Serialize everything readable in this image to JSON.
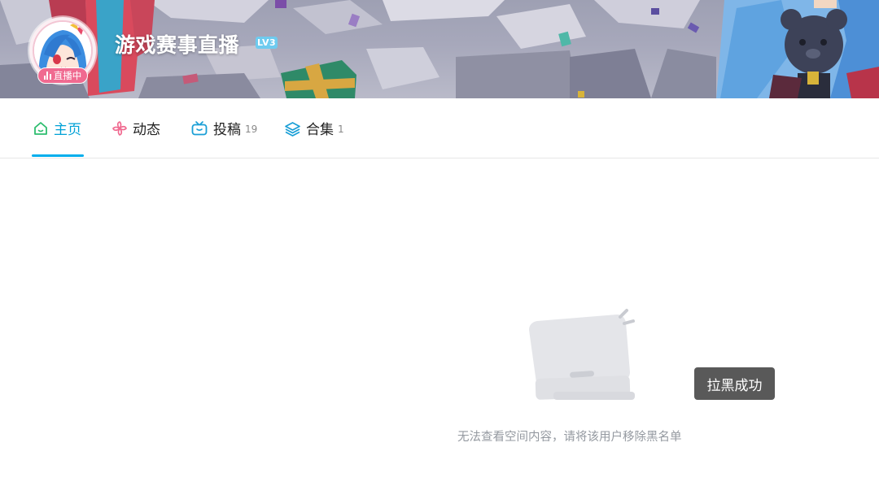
{
  "profile": {
    "username": "游戏赛事直播",
    "level": "LV3",
    "live_badge": "直播中"
  },
  "tabs": [
    {
      "label": "主页",
      "count": "",
      "icon": "home-icon",
      "active": true
    },
    {
      "label": "动态",
      "count": "",
      "icon": "pinwheel-icon",
      "active": false
    },
    {
      "label": "投稿",
      "count": "19",
      "icon": "tv-icon",
      "active": false
    },
    {
      "label": "合集",
      "count": "1",
      "icon": "layers-icon",
      "active": false
    }
  ],
  "empty_state": {
    "message": "无法查看空间内容，请将该用户移除黑名单",
    "icon": "empty-laptop-icon"
  },
  "toast": {
    "message": "拉黑成功"
  },
  "colors": {
    "accent": "#00a1d6",
    "tab_indicator": "#00aeec",
    "live_badge": "#f06a90",
    "level_badge": "#6ecbef",
    "home_icon": "#2dbd6e",
    "dynamic_icon": "#f06a90"
  }
}
